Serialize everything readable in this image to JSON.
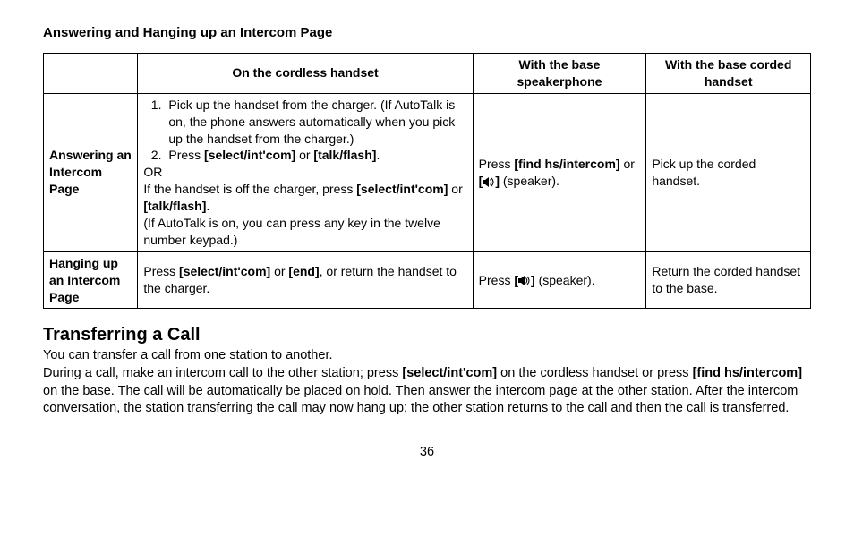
{
  "section_title": "Answering and Hanging up an Intercom Page",
  "table": {
    "headers": {
      "blank": "",
      "cordless": "On the cordless handset",
      "speaker": "With the base speakerphone",
      "corded": "With the base corded handset"
    },
    "rows": {
      "answer": {
        "label": "Answering an Intercom Page",
        "cordless": {
          "step1_a": "Pick up the handset from the charger. (If AutoTalk is on, the phone answers automatically when you pick up the handset from the charger.)",
          "step2_a": "Press ",
          "step2_btn1": "[select/int'com]",
          "step2_b": " or ",
          "step2_btn2": "[talk/flash]",
          "step2_c": ".",
          "or": "OR",
          "line3_a": "If the handset is off the charger, press ",
          "line3_btn1": "[select/int'com]",
          "line3_b": " or ",
          "line3_btn2": "[talk/flash]",
          "line3_c": ".",
          "line4": "(If AutoTalk is on, you can press any key in the twelve number keypad.)"
        },
        "speaker": {
          "a": "Press ",
          "btn": "[find hs/intercom]",
          "b": " or ",
          "bracket_open": "[",
          "bracket_close": "]",
          "c": " (speaker)."
        },
        "corded": "Pick up the corded handset."
      },
      "hang": {
        "label": "Hanging up an Intercom Page",
        "cordless": {
          "a": "Press ",
          "btn1": "[select/int'com]",
          "b": " or ",
          "btn2": "[end]",
          "c": ", or return the handset to the charger."
        },
        "speaker": {
          "a": "Press ",
          "bracket_open": "[",
          "bracket_close": "]",
          "b": " (speaker)."
        },
        "corded": "Return the corded handset to the base."
      }
    }
  },
  "transfer": {
    "heading": "Transferring a Call",
    "line1": "You can transfer a call from one station to another.",
    "p_a": "During a call, make an intercom call to the other station; press ",
    "btn1": "[select/int'com]",
    "p_b": " on the cordless handset or press ",
    "btn2": "[find hs/intercom]",
    "p_c": " on the base. The call will be automatically be placed on hold. Then answer the intercom page at the other station. After the intercom conversation, the station transferring the call may now hang up; the other station returns to the call and then the call is transferred."
  },
  "page_number": "36"
}
